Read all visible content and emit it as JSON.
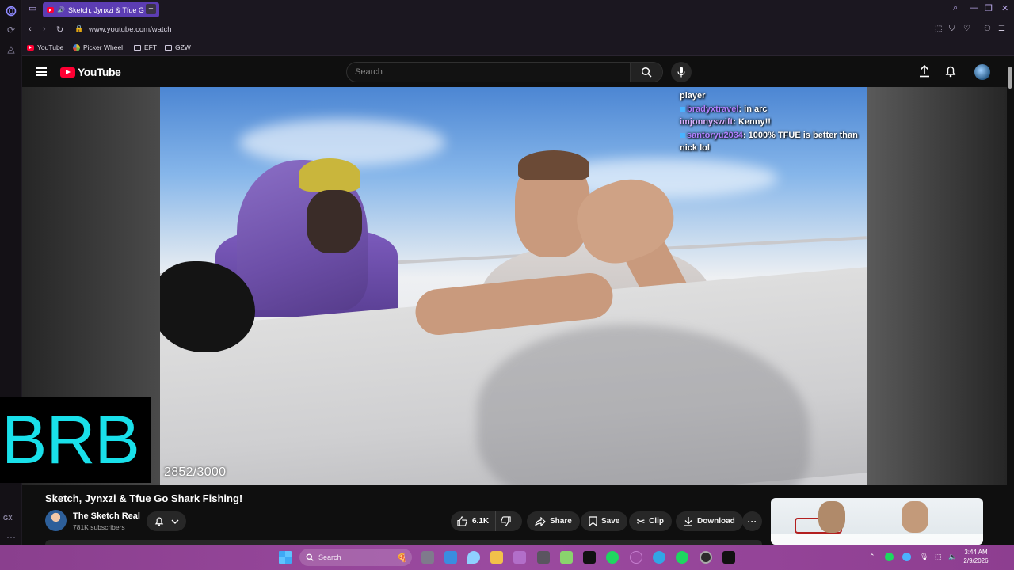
{
  "browser": {
    "tab_title": "Sketch, Jynxzi & Tfue G",
    "new_tab_label": "+",
    "url": "www.youtube.com/watch",
    "bookmarks": [
      {
        "label": "YouTube",
        "icon": "youtube-icon"
      },
      {
        "label": "Picker Wheel",
        "icon": "wheel-icon"
      },
      {
        "label": "EFT",
        "icon": "folder-icon"
      },
      {
        "label": "GZW",
        "icon": "folder-icon"
      }
    ],
    "rail_badge": "GX",
    "accent": "#5c3db3"
  },
  "youtube": {
    "logo_text": "YouTube",
    "search_placeholder": "Search",
    "brand_color": "#ff0033"
  },
  "player": {
    "chat": [
      {
        "user": "",
        "text": "player"
      },
      {
        "user": "bradyxtravel",
        "text": ": in arc"
      },
      {
        "user": "imjonnyswift",
        "text": ": Kenny!!"
      },
      {
        "user": "santoryu2034",
        "text": ": 1000% TFUE is better than nick lol"
      }
    ],
    "counter": "2852/3000"
  },
  "overlay": {
    "brb_text": "BRB",
    "brb_color": "#19e0ea"
  },
  "video": {
    "title": "Sketch, Jynxzi & Tfue Go Shark Fishing!",
    "channel_name": "The Sketch Real",
    "subscribers": "781K subscribers",
    "likes": "6.1K",
    "share_label": "Share",
    "save_label": "Save",
    "clip_label": "Clip",
    "download_label": "Download",
    "more_label": "···"
  },
  "taskbar": {
    "search_label": "Search",
    "time": "3:44 AM",
    "date": "2/9/2026"
  }
}
